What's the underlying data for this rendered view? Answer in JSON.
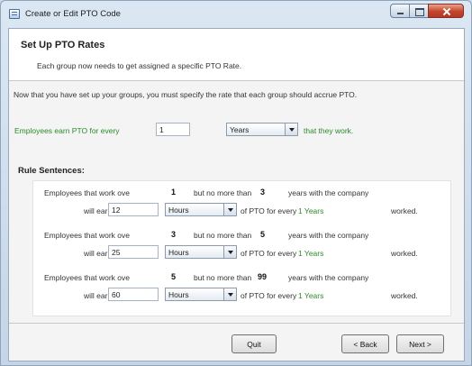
{
  "window": {
    "title": "Create or Edit PTO Code"
  },
  "header": {
    "title": "Set Up PTO Rates",
    "subtitle": "Each group now needs to get assigned a specific PTO Rate."
  },
  "intro": "Now that you have set up your groups, you must specify the rate that each group should accrue PTO.",
  "earn_line": {
    "prefix": "Employees earn PTO for every",
    "amount": "1",
    "unit": "Years",
    "suffix": "that they work."
  },
  "rules_heading": "Rule Sentences:",
  "rules": [
    {
      "works_over_label": "Employees that work ove",
      "from": "1",
      "no_more_label": "but no more than",
      "to": "3",
      "years_label": "years with the company",
      "will_earn_label": "will earn",
      "earn_value": "12",
      "earn_unit": "Hours",
      "of_pto_label": "of PTO for every",
      "every_value": "1 Years",
      "worked_label": "worked."
    },
    {
      "works_over_label": "Employees that work ove",
      "from": "3",
      "no_more_label": "but no more than",
      "to": "5",
      "years_label": "years with the company",
      "will_earn_label": "will earn",
      "earn_value": "25",
      "earn_unit": "Hours",
      "of_pto_label": "of PTO for every",
      "every_value": "1 Years",
      "worked_label": "worked."
    },
    {
      "works_over_label": "Employees that work ove",
      "from": "5",
      "no_more_label": "but no more than",
      "to": "99",
      "years_label": "years with the company",
      "will_earn_label": "will earn",
      "earn_value": "60",
      "earn_unit": "Hours",
      "of_pto_label": "of PTO for every",
      "every_value": "1 Years",
      "worked_label": "worked."
    }
  ],
  "buttons": {
    "quit": "Quit",
    "back": "< Back",
    "next": "Next >"
  }
}
